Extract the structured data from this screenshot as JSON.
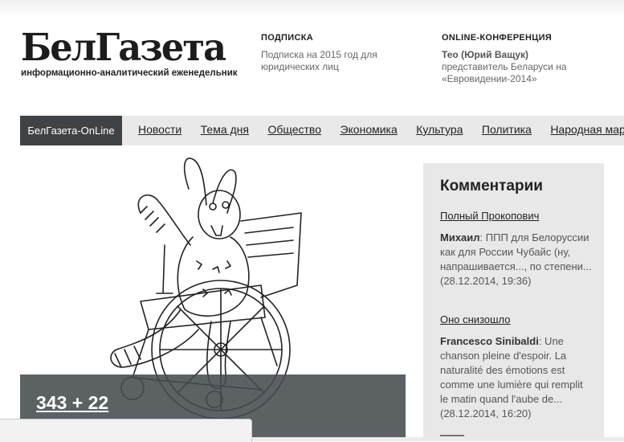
{
  "logo": {
    "text": "БелГазета",
    "tagline": "информационно-аналитический еженедельник"
  },
  "subscription": {
    "title": "ПОДПИСКА",
    "text": "Подписка на 2015 год для юридических лиц"
  },
  "conference": {
    "title": "ONLINE-КОНФЕРЕНЦИЯ",
    "name": "Тео (Юрий Ващук)",
    "text": "представитель Беларуси на «Евровидении-2014»"
  },
  "nav": {
    "home": "БелГазета-OnLine",
    "items": [
      "Новости",
      "Тема дня",
      "Общество",
      "Экономика",
      "Культура",
      "Политика",
      "Народная марка"
    ]
  },
  "feature": {
    "title": "343 + 22"
  },
  "sidebar": {
    "title": "Комментарии",
    "comments": [
      {
        "topic": "Полный Прокопович",
        "author": "Михаил",
        "text": ": ППП для Белоруссии как для России Чубайс (ну, напрашивается..., по степени... (28.12.2014, 19:36)"
      },
      {
        "topic": "Оно снизошло",
        "author": "Francesco Sinibaldi",
        "text": ": Une chanson pleine d'espoir. La naturalité des émotions est comme une lumière qui remplit le matin quand l'aube de... (28.12.2014, 16:20)"
      }
    ]
  },
  "colors": {
    "nav_home_bg": "#3f4346",
    "nav_bg": "#e9e9e9",
    "sidebar_bg": "#e8e8e8",
    "caption_bg": "#464b4e"
  }
}
